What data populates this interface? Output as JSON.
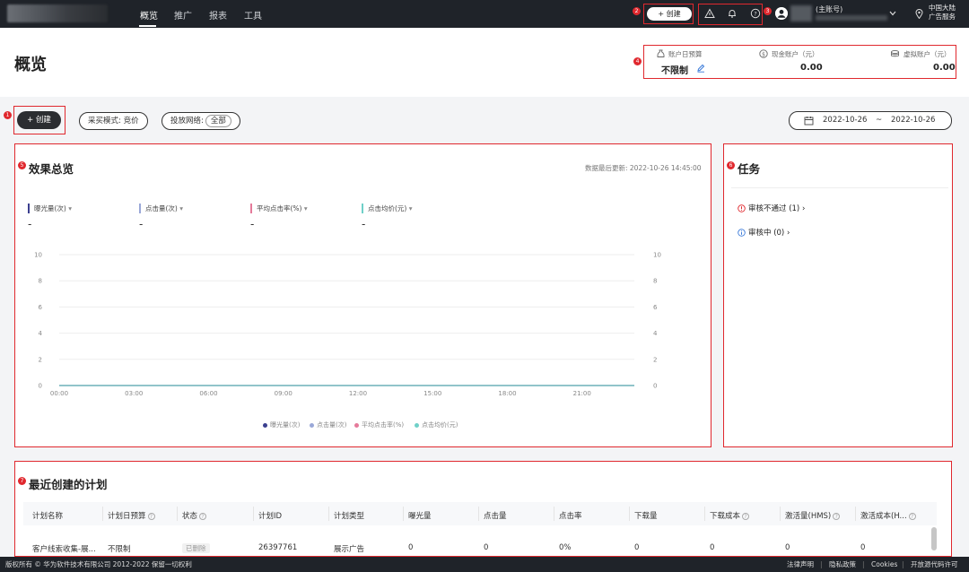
{
  "topnav": {
    "items": [
      "概览",
      "推广",
      "报表",
      "工具"
    ],
    "create_label": "+ 创建",
    "account_suffix": "(主账号)",
    "region_line1": "中国大陆",
    "region_line2": "广告服务"
  },
  "badges": [
    "1",
    "2",
    "3",
    "4",
    "5",
    "6",
    "7"
  ],
  "page": {
    "title": "概览"
  },
  "budget": {
    "daily_label": "账户日预算",
    "daily_value": "不限制",
    "cash_label": "现金账户（元）",
    "cash_value": "0.00",
    "virtual_label": "虚拟账户（元）",
    "virtual_value": "0.00"
  },
  "toolbar": {
    "create_label": "+ 创建",
    "mode_label": "采买模式: 竞价",
    "network_label": "投放网络:",
    "network_value": "全部",
    "date_start": "2022-10-26",
    "date_sep": "~",
    "date_end": "2022-10-26"
  },
  "overview": {
    "title": "效果总览",
    "updated": "数据最后更新: 2022-10-26 14:45:00",
    "metrics": [
      {
        "label": "曝光量(次)",
        "value": "-",
        "color": "#3b3f8f"
      },
      {
        "label": "点击量(次)",
        "value": "-",
        "color": "#9aa8d8"
      },
      {
        "label": "平均点击率(%)",
        "value": "-",
        "color": "#e57a9a"
      },
      {
        "label": "点击均价(元)",
        "value": "-",
        "color": "#6fd0c8"
      }
    ]
  },
  "chart_data": {
    "type": "line",
    "x": [
      "00:00",
      "03:00",
      "06:00",
      "09:00",
      "12:00",
      "15:00",
      "18:00",
      "21:00"
    ],
    "y_ticks": [
      10,
      8,
      6,
      4,
      2,
      0
    ],
    "ylim": [
      0,
      10
    ],
    "series": [
      {
        "name": "曝光量(次)",
        "color": "#3b3f8f",
        "values": [
          0,
          0,
          0,
          0,
          0,
          0,
          0,
          0
        ]
      },
      {
        "name": "点击量(次)",
        "color": "#9aa8d8",
        "values": [
          0,
          0,
          0,
          0,
          0,
          0,
          0,
          0
        ]
      },
      {
        "name": "平均点击率(%)",
        "color": "#e57a9a",
        "values": [
          0,
          0,
          0,
          0,
          0,
          0,
          0,
          0
        ]
      },
      {
        "name": "点击均价(元)",
        "color": "#6fd0c8",
        "values": [
          0,
          0,
          0,
          0,
          0,
          0,
          0,
          0
        ]
      }
    ],
    "grid": true,
    "legend": "bottom"
  },
  "tasks": {
    "title": "任务",
    "items": [
      {
        "label": "审核不通过 (1)",
        "color": "#e0282e"
      },
      {
        "label": "审核中 (0)",
        "color": "#3a7ad9"
      }
    ]
  },
  "recent": {
    "title": "最近创建的计划",
    "columns": [
      "计划名称",
      "计划日预算",
      "状态",
      "计划ID",
      "计划类型",
      "曝光量",
      "点击量",
      "点击率",
      "下载量",
      "下载成本",
      "激活量(HMS)",
      "激活成本(H..."
    ],
    "row": [
      "客户线索收集-展...",
      "不限制",
      "已删除",
      "26397761",
      "展示广告",
      "0",
      "0",
      "0%",
      "0",
      "0",
      "0",
      "0"
    ]
  },
  "footer": {
    "copyright": "版权所有 © 华为软件技术有限公司 2012-2022 保留一切权利",
    "links": [
      "法律声明",
      "隐私政策",
      "Cookies",
      "开放源代码许可"
    ]
  }
}
